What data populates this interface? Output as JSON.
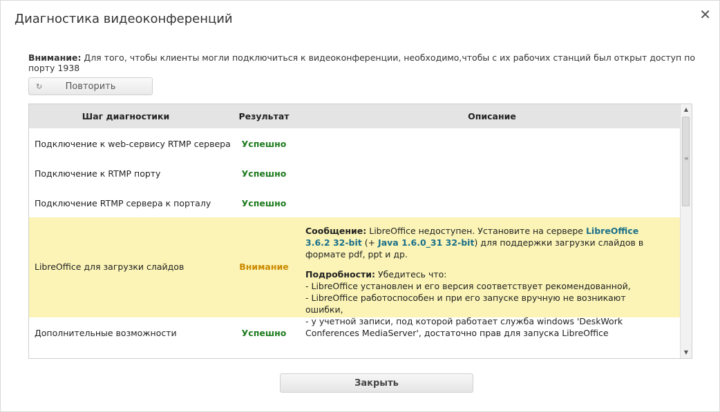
{
  "dialog": {
    "title": "Диагностика видеоконференций",
    "close_icon": "close-icon"
  },
  "warning": {
    "label": "Внимание:",
    "text": " Для того, чтобы клиенты могли подключиться к видеоконференции, необходимо,чтобы с их рабочих станций был открыт доступ по порту 1938"
  },
  "retry": {
    "label": "Повторить",
    "icon": "refresh-icon"
  },
  "table": {
    "headers": [
      "Шаг диагностики",
      "Результат",
      "Описание"
    ],
    "rows": [
      {
        "step": "Подключение к web-сервису RTMP сервера",
        "result": "Успешно"
      },
      {
        "step": "Подключение к RTMP порту",
        "result": "Успешно"
      },
      {
        "step": "Подключение RTMP сервера к порталу",
        "result": "Успешно"
      },
      {
        "step": "LibreOffice для загрузки слайдов",
        "result": "Внимание",
        "message_label": "Сообщение:",
        "message_text1": " LibreOffice недоступен. Установите на сервере ",
        "message_link1": "LibreOffice 3.6.2 32-bit",
        "message_text2": " (+ ",
        "message_link2": "Java 1.6.0_31 32-bit",
        "message_text3": ") для поддержки загрузки слайдов в формате pdf, ppt и др.",
        "details_label": "Подробности:",
        "details_intro": " Убедитесь что:",
        "details_lines": [
          "- LibreOffice установлен и его версия соответствует рекомендованной,",
          "- LibreOffice работоспособен и при его запуске вручную не возникают ошибки,",
          "- у учетной записи, под которой работает служба windows 'DeskWork Conferences MediaServer', достаточно прав для запуска LibreOffice"
        ]
      },
      {
        "step": "Дополнительные возможности",
        "result": "Успешно"
      }
    ]
  },
  "close_button": {
    "label": "Закрыть"
  },
  "colors": {
    "success": "#1e7b1e",
    "warning": "#cc8a00",
    "highlight": "#fbf4b6",
    "link": "#1b6f8a",
    "header_bg": "#e4e4e4"
  }
}
